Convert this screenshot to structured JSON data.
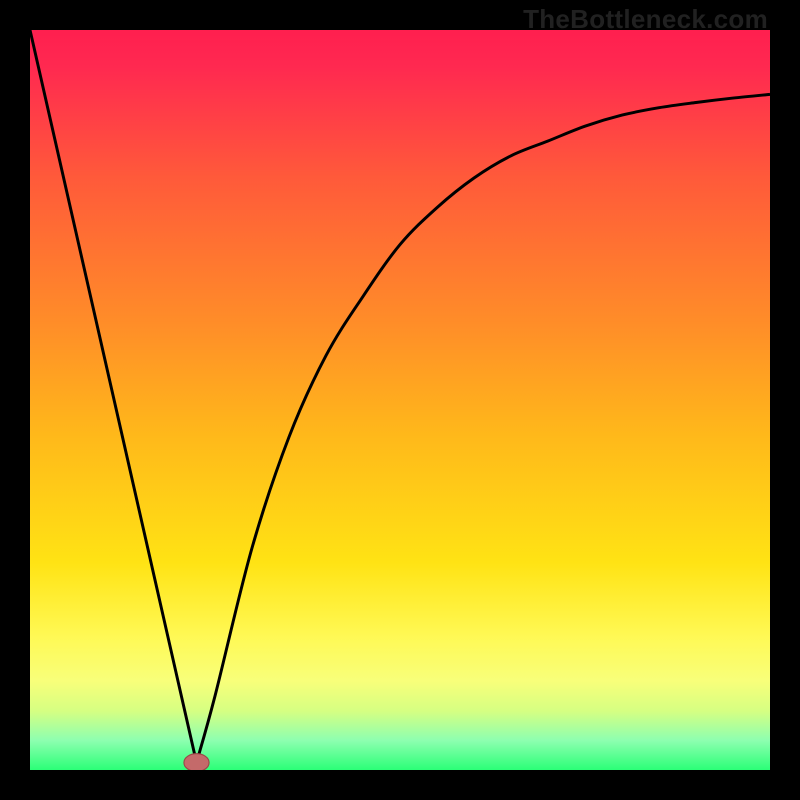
{
  "watermark": "TheBottleneck.com",
  "colors": {
    "stroke": "#000000",
    "marker_fill": "#c46a6a",
    "marker_stroke": "#9a4747"
  },
  "gradient_stops": [
    {
      "offset": 0.0,
      "color": "#ff1f4f"
    },
    {
      "offset": 0.05,
      "color": "#ff2950"
    },
    {
      "offset": 0.2,
      "color": "#ff5a3a"
    },
    {
      "offset": 0.4,
      "color": "#ff8e28"
    },
    {
      "offset": 0.55,
      "color": "#ffb91a"
    },
    {
      "offset": 0.72,
      "color": "#ffe314"
    },
    {
      "offset": 0.82,
      "color": "#fff955"
    },
    {
      "offset": 0.88,
      "color": "#f8ff7a"
    },
    {
      "offset": 0.92,
      "color": "#d6ff82"
    },
    {
      "offset": 0.96,
      "color": "#8dffb0"
    },
    {
      "offset": 1.0,
      "color": "#2bff77"
    }
  ],
  "chart_data": {
    "type": "line",
    "title": "",
    "xlabel": "",
    "ylabel": "",
    "xlim": [
      0,
      100
    ],
    "ylim": [
      0,
      100
    ],
    "series": [
      {
        "name": "bottleneck-curve",
        "x": [
          0,
          5,
          10,
          15,
          20,
          22.5,
          25,
          30,
          35,
          40,
          45,
          50,
          55,
          60,
          65,
          70,
          75,
          80,
          85,
          90,
          95,
          100
        ],
        "values": [
          100,
          78,
          56,
          34,
          12,
          1,
          10,
          30,
          45,
          56,
          64,
          71,
          76,
          80,
          83,
          85,
          87,
          88.5,
          89.5,
          90.2,
          90.8,
          91.3
        ]
      }
    ],
    "marker": {
      "x": 22.5,
      "y": 1,
      "rx": 1.7,
      "ry": 1.2
    },
    "annotations": []
  }
}
